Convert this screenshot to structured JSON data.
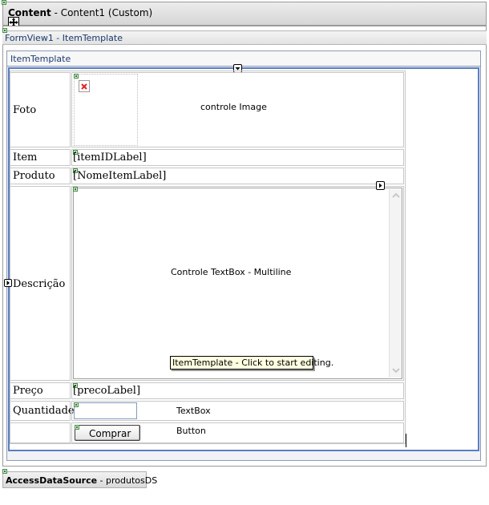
{
  "content_header": {
    "bold": "Content",
    "rest": " - Content1 (Custom)"
  },
  "formview_header": "FormView1 - ItemTemplate",
  "itemtemplate_tab": "ItemTemplate",
  "rows": {
    "foto": "Foto",
    "item": "Item",
    "produto": "Produto",
    "descricao": "Descrição",
    "preco": "Preço",
    "quantidade": "Quantidade"
  },
  "image_label": "controle Image",
  "item_id_label": "[itemIDLabel]",
  "nome_item_label": "[NomeItemLabel]",
  "textbox_multiline_label": "Controle TextBox - Multiline",
  "tooltip": "ItemTemplate - Click to start editing.",
  "preco_label": "[precoLabel]",
  "textbox_label": "TextBox",
  "comprar_button": "Comprar",
  "button_label": "Button",
  "datasource": {
    "bold": "AccessDataSource",
    "rest": " - produtosDS"
  }
}
